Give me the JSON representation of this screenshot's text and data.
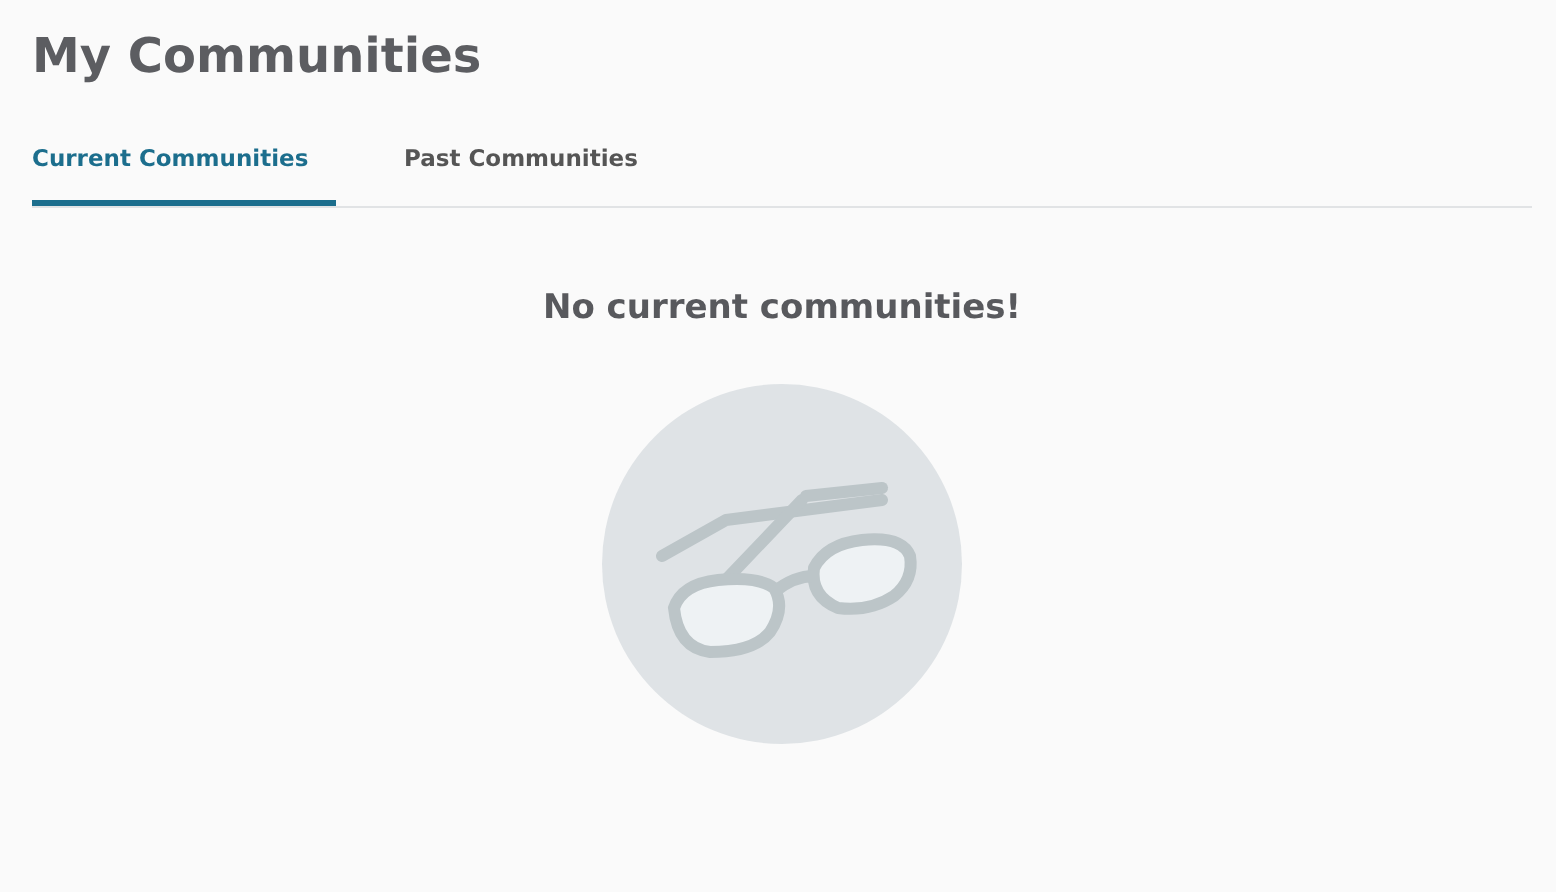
{
  "page": {
    "title": "My Communities"
  },
  "tabs": [
    {
      "label": "Current Communities",
      "selected": true
    },
    {
      "label": "Past Communities",
      "selected": false
    }
  ],
  "empty_state": {
    "message": "No current communities!"
  }
}
